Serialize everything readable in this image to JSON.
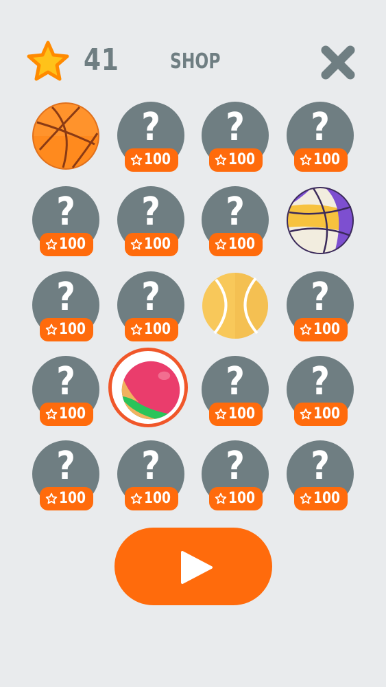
{
  "header": {
    "coins": "41",
    "title": "SHOP",
    "icons": {
      "currency": "star-icon",
      "close": "close-icon"
    }
  },
  "colors": {
    "background": "#e9ebed",
    "locked": "#6f7e82",
    "accent": "#ff6b0c",
    "selected_ring": "#f0572a"
  },
  "shop": {
    "items": [
      {
        "state": "owned",
        "ball": "basketball"
      },
      {
        "state": "locked",
        "mark": "?",
        "price": "100"
      },
      {
        "state": "locked",
        "mark": "?",
        "price": "100"
      },
      {
        "state": "locked",
        "mark": "?",
        "price": "100"
      },
      {
        "state": "locked",
        "mark": "?",
        "price": "100"
      },
      {
        "state": "locked",
        "mark": "?",
        "price": "100"
      },
      {
        "state": "locked",
        "mark": "?",
        "price": "100"
      },
      {
        "state": "owned",
        "ball": "purple-yellow-basketball"
      },
      {
        "state": "locked",
        "mark": "?",
        "price": "100"
      },
      {
        "state": "locked",
        "mark": "?",
        "price": "100"
      },
      {
        "state": "owned",
        "ball": "tennis-ball"
      },
      {
        "state": "locked",
        "mark": "?",
        "price": "100"
      },
      {
        "state": "locked",
        "mark": "?",
        "price": "100"
      },
      {
        "state": "selected",
        "ball": "pink-beach-ball"
      },
      {
        "state": "locked",
        "mark": "?",
        "price": "100"
      },
      {
        "state": "locked",
        "mark": "?",
        "price": "100"
      },
      {
        "state": "locked",
        "mark": "?",
        "price": "100"
      },
      {
        "state": "locked",
        "mark": "?",
        "price": "100"
      },
      {
        "state": "locked",
        "mark": "?",
        "price": "100"
      },
      {
        "state": "locked",
        "mark": "?",
        "price": "100"
      }
    ]
  },
  "play": {
    "icon": "play-icon"
  }
}
